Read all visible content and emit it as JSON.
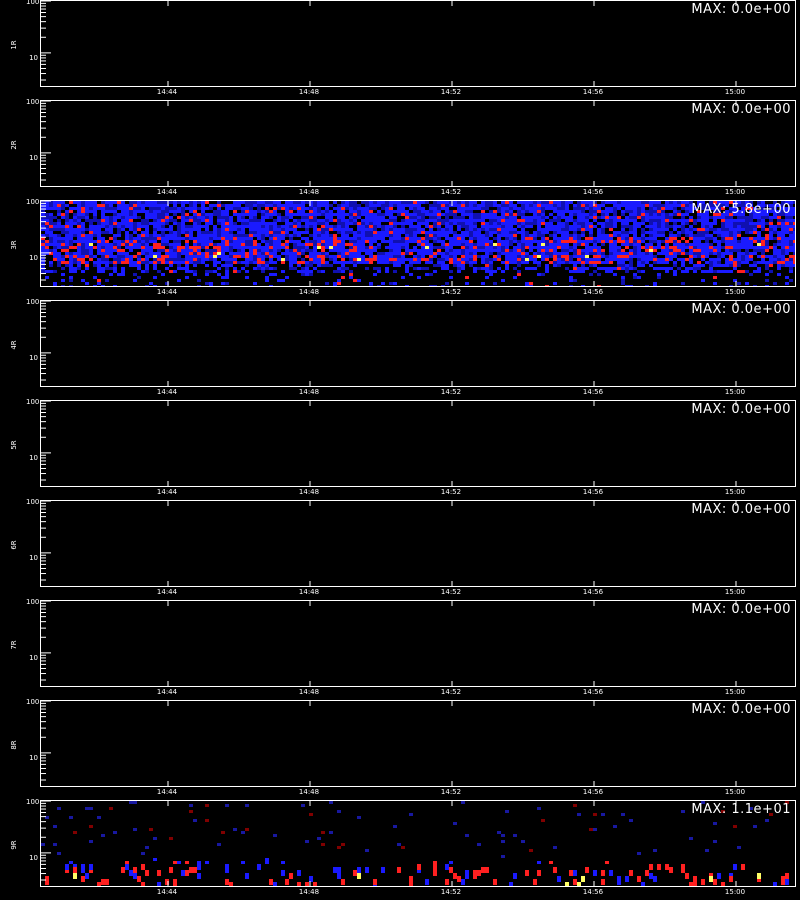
{
  "chart_data": [
    {
      "type": "heatmap",
      "ylabel": "1R",
      "max_label": "MAX: 0.0e+00",
      "max": 0.0,
      "yticks": [
        "100",
        "10"
      ],
      "xticks": [
        "14:44",
        "14:48",
        "14:52",
        "14:56",
        "15:00"
      ],
      "pattern": "empty"
    },
    {
      "type": "heatmap",
      "ylabel": "2R",
      "max_label": "MAX: 0.0e+00",
      "max": 0.0,
      "yticks": [
        "100",
        "10"
      ],
      "xticks": [
        "14:44",
        "14:48",
        "14:52",
        "14:56",
        "15:00"
      ],
      "pattern": "empty"
    },
    {
      "type": "heatmap",
      "ylabel": "3R",
      "max_label": "MAX: 5.8e+00",
      "max": 5.8,
      "yticks": [
        "100",
        "10"
      ],
      "xticks": [
        "14:44",
        "14:48",
        "14:52",
        "14:56",
        "15:00"
      ],
      "pattern": "dense"
    },
    {
      "type": "heatmap",
      "ylabel": "4R",
      "max_label": "MAX: 0.0e+00",
      "max": 0.0,
      "yticks": [
        "100",
        "10"
      ],
      "xticks": [
        "14:44",
        "14:48",
        "14:52",
        "14:56",
        "15:00"
      ],
      "pattern": "empty"
    },
    {
      "type": "heatmap",
      "ylabel": "5R",
      "max_label": "MAX: 0.0e+00",
      "max": 0.0,
      "yticks": [
        "100",
        "10"
      ],
      "xticks": [
        "14:44",
        "14:48",
        "14:52",
        "14:56",
        "15:00"
      ],
      "pattern": "empty"
    },
    {
      "type": "heatmap",
      "ylabel": "6R",
      "max_label": "MAX: 0.0e+00",
      "max": 0.0,
      "yticks": [
        "100",
        "10"
      ],
      "xticks": [
        "14:44",
        "14:48",
        "14:52",
        "14:56",
        "15:00"
      ],
      "pattern": "empty"
    },
    {
      "type": "heatmap",
      "ylabel": "7R",
      "max_label": "MAX: 0.0e+00",
      "max": 0.0,
      "yticks": [
        "100",
        "10"
      ],
      "xticks": [
        "14:44",
        "14:48",
        "14:52",
        "14:56",
        "15:00"
      ],
      "pattern": "empty"
    },
    {
      "type": "heatmap",
      "ylabel": "8R",
      "max_label": "MAX: 0.0e+00",
      "max": 0.0,
      "yticks": [
        "100",
        "10"
      ],
      "xticks": [
        "14:44",
        "14:48",
        "14:52",
        "14:56",
        "15:00"
      ],
      "pattern": "empty"
    },
    {
      "type": "heatmap",
      "ylabel": "9R",
      "max_label": "MAX: 1.1e+01",
      "max": 11.0,
      "yticks": [
        "100",
        "10"
      ],
      "xticks": [
        "14:44",
        "14:48",
        "14:52",
        "14:56",
        "15:00"
      ],
      "pattern": "sparse"
    }
  ],
  "colors": {
    "background": "#000000",
    "axis": "#ffffff",
    "low": "#1a1aff",
    "mid": "#ff2020",
    "high": "#ffff66"
  }
}
